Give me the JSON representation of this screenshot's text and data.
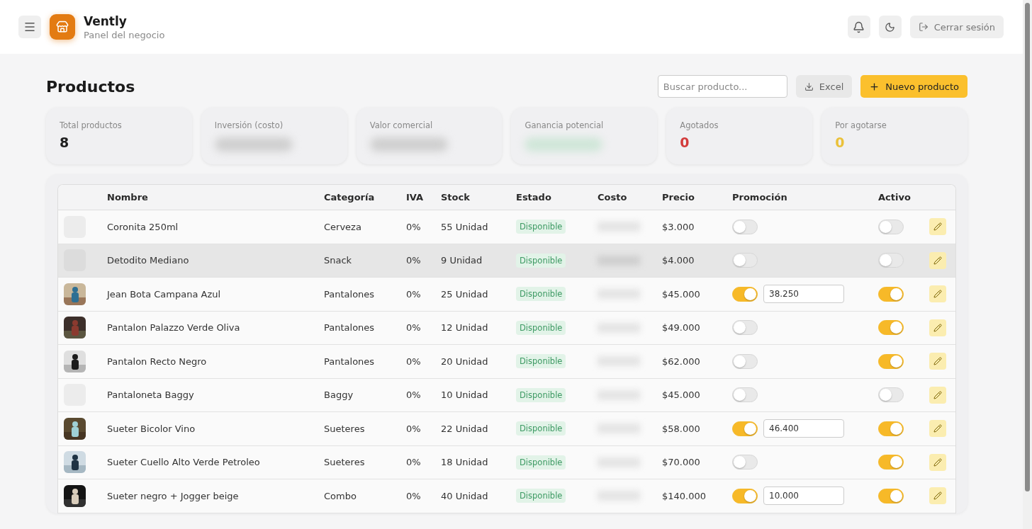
{
  "app": {
    "name": "Vently",
    "subtitle": "Panel del negocio"
  },
  "header_actions": {
    "logout": "Cerrar sesión"
  },
  "page": {
    "title": "Productos",
    "search": {
      "placeholder": "Buscar producto..."
    },
    "export_button": "Excel",
    "new_button": "Nuevo producto"
  },
  "stats": [
    {
      "label": "Total productos",
      "value": "8",
      "kind": "neutral",
      "hidden": false
    },
    {
      "label": "Inversión (costo)",
      "kind": "neutral",
      "hidden": true
    },
    {
      "label": "Valor comercial",
      "kind": "neutral",
      "hidden": true
    },
    {
      "label": "Ganancia potencial",
      "kind": "positive",
      "hidden": true
    },
    {
      "label": "Agotados",
      "value": "0",
      "kind": "danger",
      "hidden": false
    },
    {
      "label": "Por agotarse",
      "value": "0",
      "kind": "warning",
      "hidden": false
    }
  ],
  "table": {
    "columns": [
      "Nombre",
      "Categoría",
      "IVA",
      "Stock",
      "Estado",
      "Costo",
      "Precio",
      "Promoción",
      "Activo"
    ],
    "rows": [
      {
        "kind": "none",
        "name": "Coronita 250ml",
        "category": "Cerveza",
        "iva": "0%",
        "stock": "55 Unidad",
        "status": "Disponible",
        "price": "$3.000",
        "promo": false,
        "active": false,
        "highlighted": false
      },
      {
        "kind": "none",
        "name": "Detodito Mediano",
        "category": "Snack",
        "iva": "0%",
        "stock": "9 Unidad",
        "status": "Disponible",
        "price": "$4.000",
        "promo": false,
        "active": false,
        "highlighted": true
      },
      {
        "kind": "picture",
        "name": "Jean Bota Campana Azul",
        "category": "Pantalones",
        "iva": "0%",
        "stock": "25 Unidad",
        "status": "Disponible",
        "price": "$45.000",
        "promo": true,
        "promo_price": "38.250",
        "active": true,
        "highlighted": false
      },
      {
        "kind": "picture",
        "name": "Pantalon Palazzo Verde Oliva",
        "category": "Pantalones",
        "iva": "0%",
        "stock": "12 Unidad",
        "status": "Disponible",
        "price": "$49.000",
        "promo": false,
        "active": true,
        "highlighted": false
      },
      {
        "kind": "picture",
        "name": "Pantalon Recto Negro",
        "category": "Pantalones",
        "iva": "0%",
        "stock": "20 Unidad",
        "status": "Disponible",
        "price": "$62.000",
        "promo": false,
        "active": true,
        "highlighted": false
      },
      {
        "kind": "none",
        "name": "Pantaloneta Baggy",
        "category": "Baggy",
        "iva": "0%",
        "stock": "10 Unidad",
        "status": "Disponible",
        "price": "$45.000",
        "promo": false,
        "active": false,
        "highlighted": false
      },
      {
        "kind": "picture",
        "name": "Sueter Bicolor Vino",
        "category": "Sueteres",
        "iva": "0%",
        "stock": "22 Unidad",
        "status": "Disponible",
        "price": "$58.000",
        "promo": true,
        "promo_price": "46.400",
        "active": true,
        "highlighted": false
      },
      {
        "kind": "picture",
        "name": "Sueter Cuello Alto Verde Petroleo",
        "category": "Sueteres",
        "iva": "0%",
        "stock": "18 Unidad",
        "status": "Disponible",
        "price": "$70.000",
        "promo": false,
        "active": true,
        "highlighted": false
      },
      {
        "kind": "picture",
        "name": "Sueter negro + Jogger beige",
        "category": "Combo",
        "iva": "0%",
        "stock": "40 Unidad",
        "status": "Disponible",
        "price": "$140.000",
        "promo": true,
        "promo_price": "10.000",
        "active": true,
        "highlighted": false
      }
    ]
  }
}
